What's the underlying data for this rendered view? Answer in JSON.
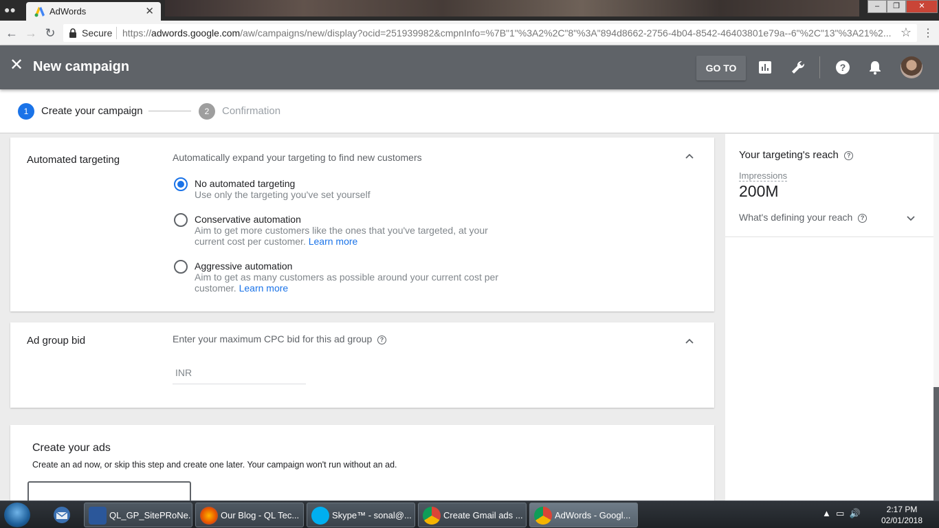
{
  "browser": {
    "tab_title": "AdWords",
    "secure_label": "Secure",
    "url_scheme": "https://",
    "url_host": "adwords.google.com",
    "url_path": "/aw/campaigns/new/display?ocid=251939982&cmpnInfo=%7B\"1\"%3A2%2C\"8\"%3A\"894d8662-2756-4b04-8542-46403801e79a--6\"%2C\"13\"%3A21%2..."
  },
  "header": {
    "title": "New campaign",
    "goto_label": "GO TO"
  },
  "stepper": {
    "steps": [
      {
        "num": "1",
        "label": "Create your campaign"
      },
      {
        "num": "2",
        "label": "Confirmation"
      }
    ]
  },
  "automated_targeting": {
    "title": "Automated targeting",
    "description": "Automatically expand your targeting to find new customers",
    "options": [
      {
        "title": "No automated targeting",
        "desc": "Use only the targeting you've set yourself",
        "link": ""
      },
      {
        "title": "Conservative automation",
        "desc": "Aim to get more customers like the ones that you've targeted, at your current cost per customer.",
        "link": "Learn more"
      },
      {
        "title": "Aggressive automation",
        "desc": "Aim to get as many customers as possible around your current cost per customer.",
        "link": "Learn more"
      }
    ]
  },
  "ad_group_bid": {
    "title": "Ad group bid",
    "description": "Enter your maximum CPC bid for this ad group",
    "currency_placeholder": "INR"
  },
  "create_ads": {
    "title": "Create your ads",
    "description": "Create an ad now, or skip this step and create one later. Your campaign won't run without an ad."
  },
  "reach": {
    "title": "Your targeting's reach",
    "impressions_label": "Impressions",
    "impressions_value": "200M",
    "defining_label": "What's defining your reach"
  },
  "taskbar": {
    "items": [
      {
        "label": "QL_GP_SitePRoNe..."
      },
      {
        "label": "Our Blog - QL Tec..."
      },
      {
        "label": "Skype™ - sonal@..."
      },
      {
        "label": "Create Gmail ads ..."
      },
      {
        "label": "AdWords - Googl..."
      }
    ],
    "time": "2:17 PM",
    "date": "02/01/2018"
  },
  "colors": {
    "accent": "#1a73e8",
    "header_bg": "#5f6368"
  }
}
